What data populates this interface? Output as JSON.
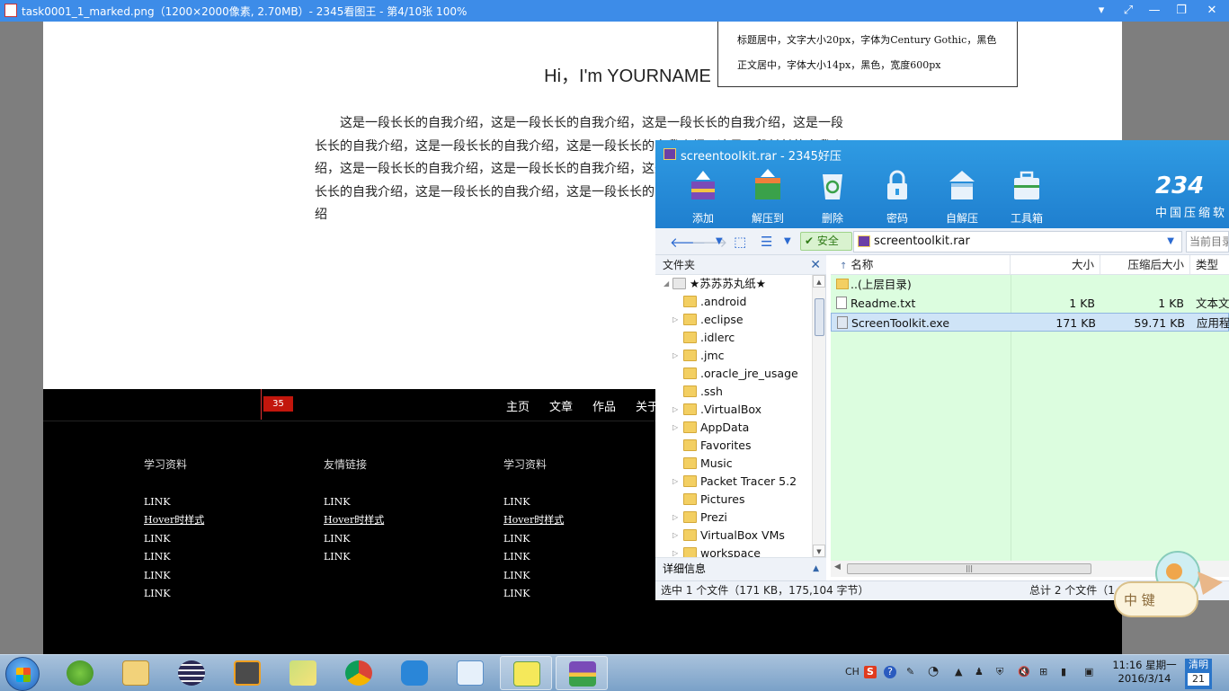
{
  "viewer": {
    "title": "task0001_1_marked.png（1200×2000像素, 2.70MB）- 2345看图王 - 第4/10张 100%",
    "controls": [
      "▾",
      "⤢",
      "—",
      "❐",
      "✕"
    ]
  },
  "webpage": {
    "title": "Hi，I'm YOURNAME",
    "intro": "这是一段长长的自我介绍，这是一段长长的自我介绍，这是一段长长的自我介绍，这是一段长长的自我介绍，这是一段长长的自我介绍，这是一段长长的自我介绍，这是一段长长的自我介绍，这是一段长长的自我介绍，这是一段长长的自我介绍，这是一段长长的自我介绍，这是一段长长的自我介绍，这是一段长长的自我介绍，这是一段长长的自我介绍，这是一段长长的自我介绍",
    "note_lines": [
      "标题居中，文字大小20px，字体为Century Gothic，黑色",
      "正文居中，字体大小14px，黑色，宽度600px"
    ],
    "measure_badge": "35",
    "nav": [
      "主页",
      "文章",
      "作品",
      "关于"
    ],
    "footer_columns": [
      {
        "heading": "学习资料",
        "links": [
          "LINK",
          "Hover时样式",
          "LINK",
          "LINK",
          "LINK",
          "LINK"
        ]
      },
      {
        "heading": "友情链接",
        "links": [
          "LINK",
          "Hover时样式",
          "LINK",
          "LINK"
        ]
      },
      {
        "heading": "学习资料",
        "links": [
          "LINK",
          "Hover时样式",
          "LINK",
          "LINK",
          "LINK",
          "LINK"
        ]
      }
    ]
  },
  "archive": {
    "title": "screentoolkit.rar - 2345好压",
    "toolbar": [
      "添加",
      "解压到",
      "删除",
      "密码",
      "自解压",
      "工具箱"
    ],
    "brand": "234",
    "brand_sub": "中国压缩软",
    "safe_label": "安全",
    "address": "screentoolkit.rar",
    "current_dir": "当前目录",
    "folder_pane_label": "文件夹",
    "tree": [
      {
        "label": "★苏苏苏丸纸★",
        "arrow": "◢"
      },
      {
        "label": ".android",
        "arrow": ""
      },
      {
        "label": ".eclipse",
        "arrow": "▷"
      },
      {
        "label": ".idlerc",
        "arrow": ""
      },
      {
        "label": ".jmc",
        "arrow": "▷"
      },
      {
        "label": ".oracle_jre_usage",
        "arrow": ""
      },
      {
        "label": ".ssh",
        "arrow": ""
      },
      {
        "label": ".VirtualBox",
        "arrow": "▷"
      },
      {
        "label": "AppData",
        "arrow": "▷"
      },
      {
        "label": "Favorites",
        "arrow": ""
      },
      {
        "label": "Music",
        "arrow": ""
      },
      {
        "label": "Packet Tracer 5.2",
        "arrow": "▷"
      },
      {
        "label": "Pictures",
        "arrow": ""
      },
      {
        "label": "Prezi",
        "arrow": "▷"
      },
      {
        "label": "VirtualBox VMs",
        "arrow": "▷"
      },
      {
        "label": "workspace",
        "arrow": "▷"
      }
    ],
    "details_label": "详细信息",
    "columns": [
      "名称",
      "大小",
      "压缩后大小",
      "类型"
    ],
    "files": [
      {
        "name": "..(上层目录)",
        "size": "",
        "packed": "",
        "type": "",
        "folder": true
      },
      {
        "name": "Readme.txt",
        "size": "1 KB",
        "packed": "1 KB",
        "type": "文本文",
        "folder": false
      },
      {
        "name": "ScreenToolkit.exe",
        "size": "171 KB",
        "packed": "59.71 KB",
        "type": "应用程",
        "folder": false
      }
    ],
    "status_left": "选中 1 个文件（171 KB，175,104 字节）",
    "status_right": "总计 2 个文件（1",
    "mascot_text": "中 键"
  },
  "taskbar": {
    "tray_text": [
      "CH",
      "S",
      "?"
    ],
    "time": "11:16 星期一",
    "date": "2016/3/14",
    "weather": "清明",
    "weather_day": "21"
  },
  "colors": {
    "titlebar": "#3d8ce8",
    "archive_header": "#2f9be3",
    "list_bg": "#dcfddf",
    "footer_bg": "#000000",
    "badge": "#c2160c"
  }
}
